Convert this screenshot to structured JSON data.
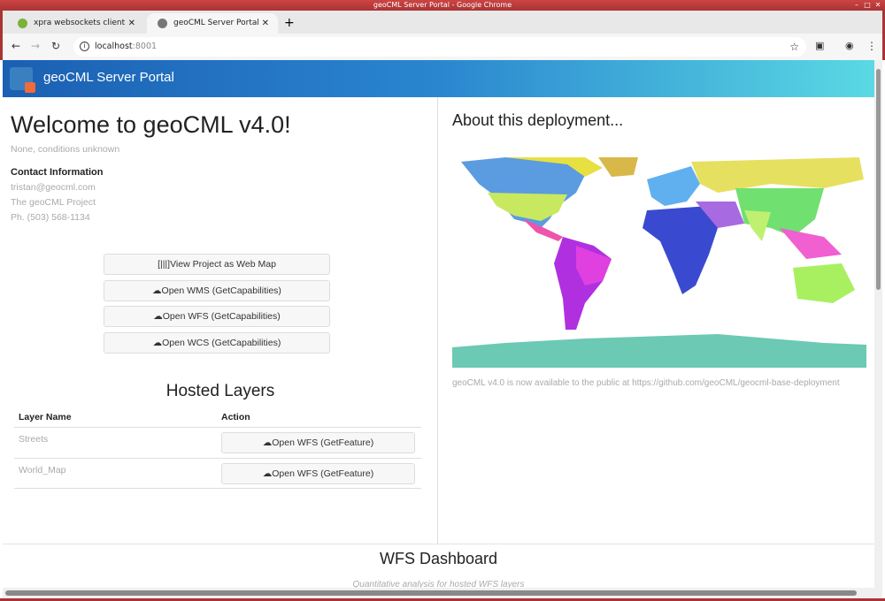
{
  "window": {
    "title": "geoCML Server Portal - Google Chrome"
  },
  "tabs": [
    {
      "label": "xpra websockets client"
    },
    {
      "label": "geoCML Server Portal"
    }
  ],
  "address": {
    "host": "localhost",
    "port": ":8001"
  },
  "header": {
    "brand": "geoCML Server Portal"
  },
  "welcome": {
    "title": "Welcome to geoCML v4.0!",
    "status": "None, conditions unknown",
    "contact_heading": "Contact Information",
    "email": "tristan@geocml.com",
    "org": "The geoCML Project",
    "phone": "Ph. (503) 568-1134"
  },
  "buttons": [
    "[|||]View Project as Web Map",
    "☁Open WMS (GetCapabilities)",
    "☁Open WFS (GetCapabilities)",
    "☁Open WCS (GetCapabilities)"
  ],
  "layers": {
    "title": "Hosted Layers",
    "headers": [
      "Layer Name",
      "Action"
    ],
    "rows": [
      {
        "name": "Streets",
        "action": "☁Open WFS (GetFeature)"
      },
      {
        "name": "World_Map",
        "action": "☁Open WFS (GetFeature)"
      }
    ]
  },
  "about": {
    "title": "About this deployment...",
    "note": "geoCML v4.0 is now available to the public at https://github.com/geoCML/geocml-base-deployment"
  },
  "dashboard": {
    "title": "WFS Dashboard",
    "subtitle": "Quantitative analysis for hosted WFS layers"
  }
}
